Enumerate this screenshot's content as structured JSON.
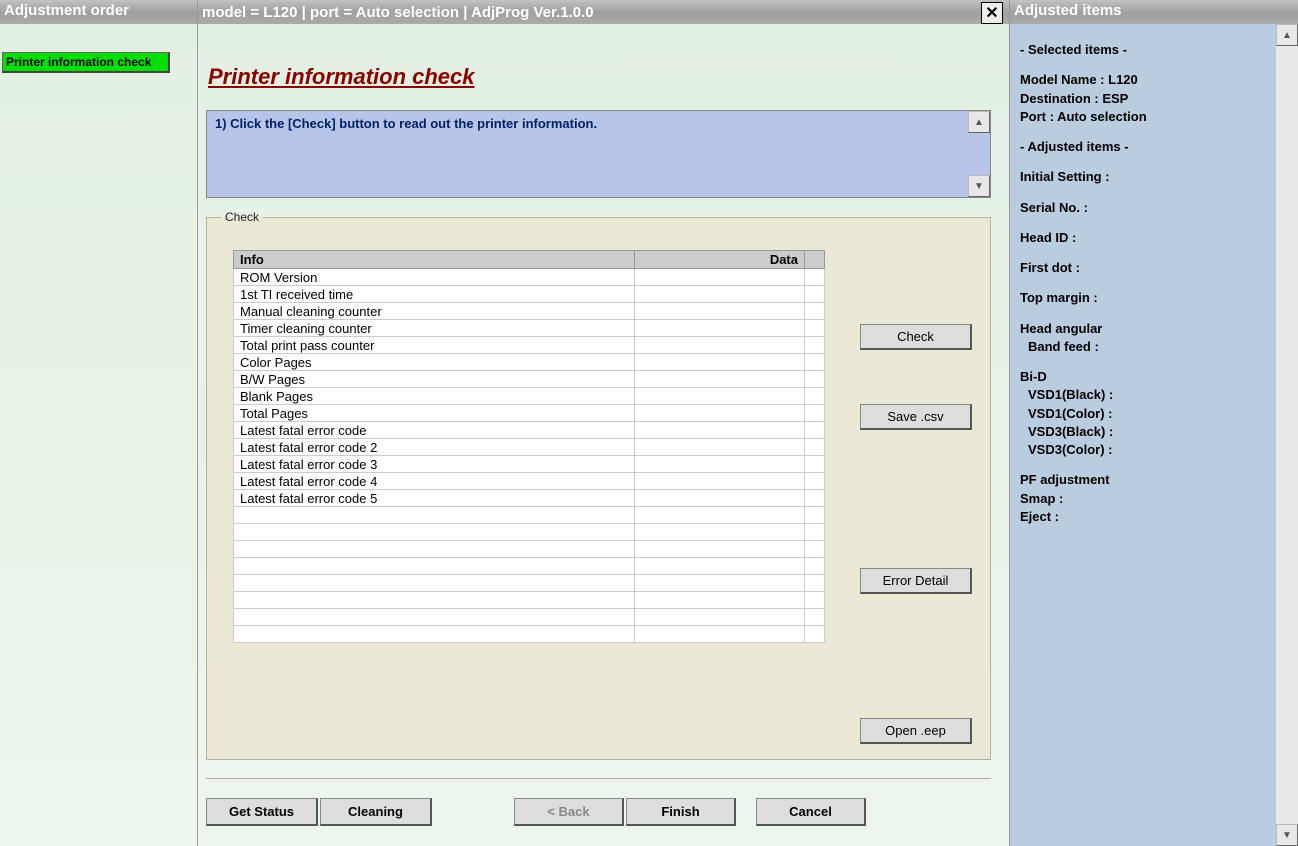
{
  "left": {
    "header": "Adjustment order",
    "item": "Printer information check"
  },
  "center": {
    "header": "model = L120  |  port = Auto selection  |  AdjProg Ver.1.0.0",
    "title": "Printer information check",
    "instruction": "1) Click the [Check] button to read out the printer information.",
    "fieldset_legend": "Check",
    "table": {
      "col_info": "Info",
      "col_data": "Data",
      "rows": [
        "ROM Version",
        "1st TI received time",
        "Manual cleaning counter",
        "Timer cleaning counter",
        "Total print pass counter",
        "Color Pages",
        "B/W Pages",
        "Blank Pages",
        "Total Pages",
        "Latest fatal error code",
        "Latest fatal error code 2",
        "Latest fatal error code 3",
        "Latest fatal error code 4",
        "Latest fatal error code 5"
      ]
    },
    "buttons": {
      "check": "Check",
      "save_csv": "Save .csv",
      "error_detail": "Error Detail",
      "open_eep": "Open .eep",
      "get_status": "Get Status",
      "cleaning": "Cleaning",
      "back": "<  Back",
      "finish": "Finish",
      "cancel": "Cancel"
    }
  },
  "right": {
    "header": "Adjusted items",
    "section_selected": "- Selected items -",
    "model_name": "Model Name : L120",
    "destination": "Destination : ESP",
    "port": "Port : Auto selection",
    "section_adjusted": "- Adjusted items -",
    "initial_setting": "Initial Setting :",
    "serial_no": "Serial No. :",
    "head_id": "Head ID :",
    "first_dot": "First dot :",
    "top_margin": "Top margin :",
    "head_angular": "Head angular",
    "band_feed": "Band feed :",
    "bi_d": "Bi-D",
    "vsd1_black": "VSD1(Black) :",
    "vsd1_color": "VSD1(Color) :",
    "vsd3_black": "VSD3(Black) :",
    "vsd3_color": "VSD3(Color) :",
    "pf_adjustment": "PF adjustment",
    "smap": "Smap :",
    "eject": "Eject :"
  }
}
